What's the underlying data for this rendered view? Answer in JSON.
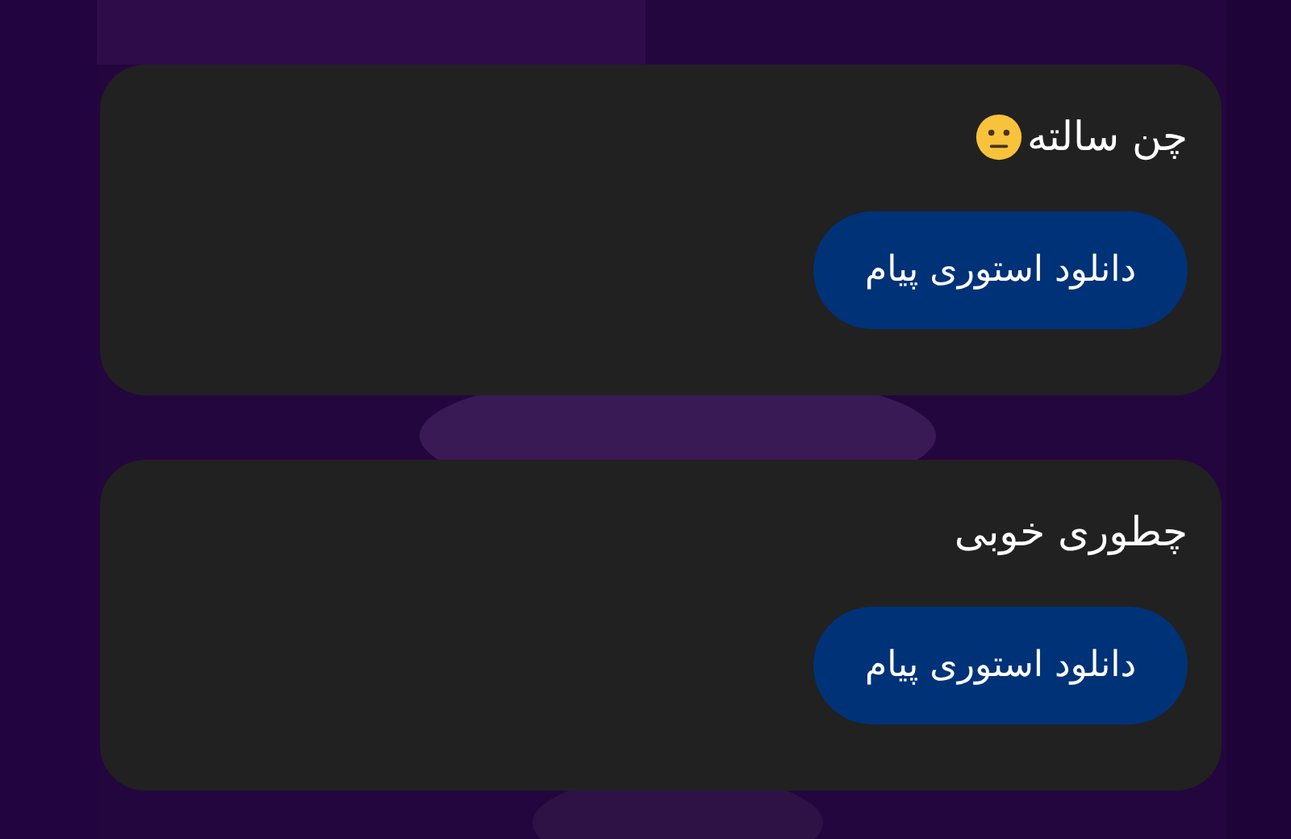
{
  "messages": [
    {
      "text": "چن سالته",
      "emoji": true,
      "button": "دانلود استوری پیام"
    },
    {
      "text": "چطوری خوبی",
      "emoji": false,
      "button": "دانلود استوری پیام"
    }
  ]
}
